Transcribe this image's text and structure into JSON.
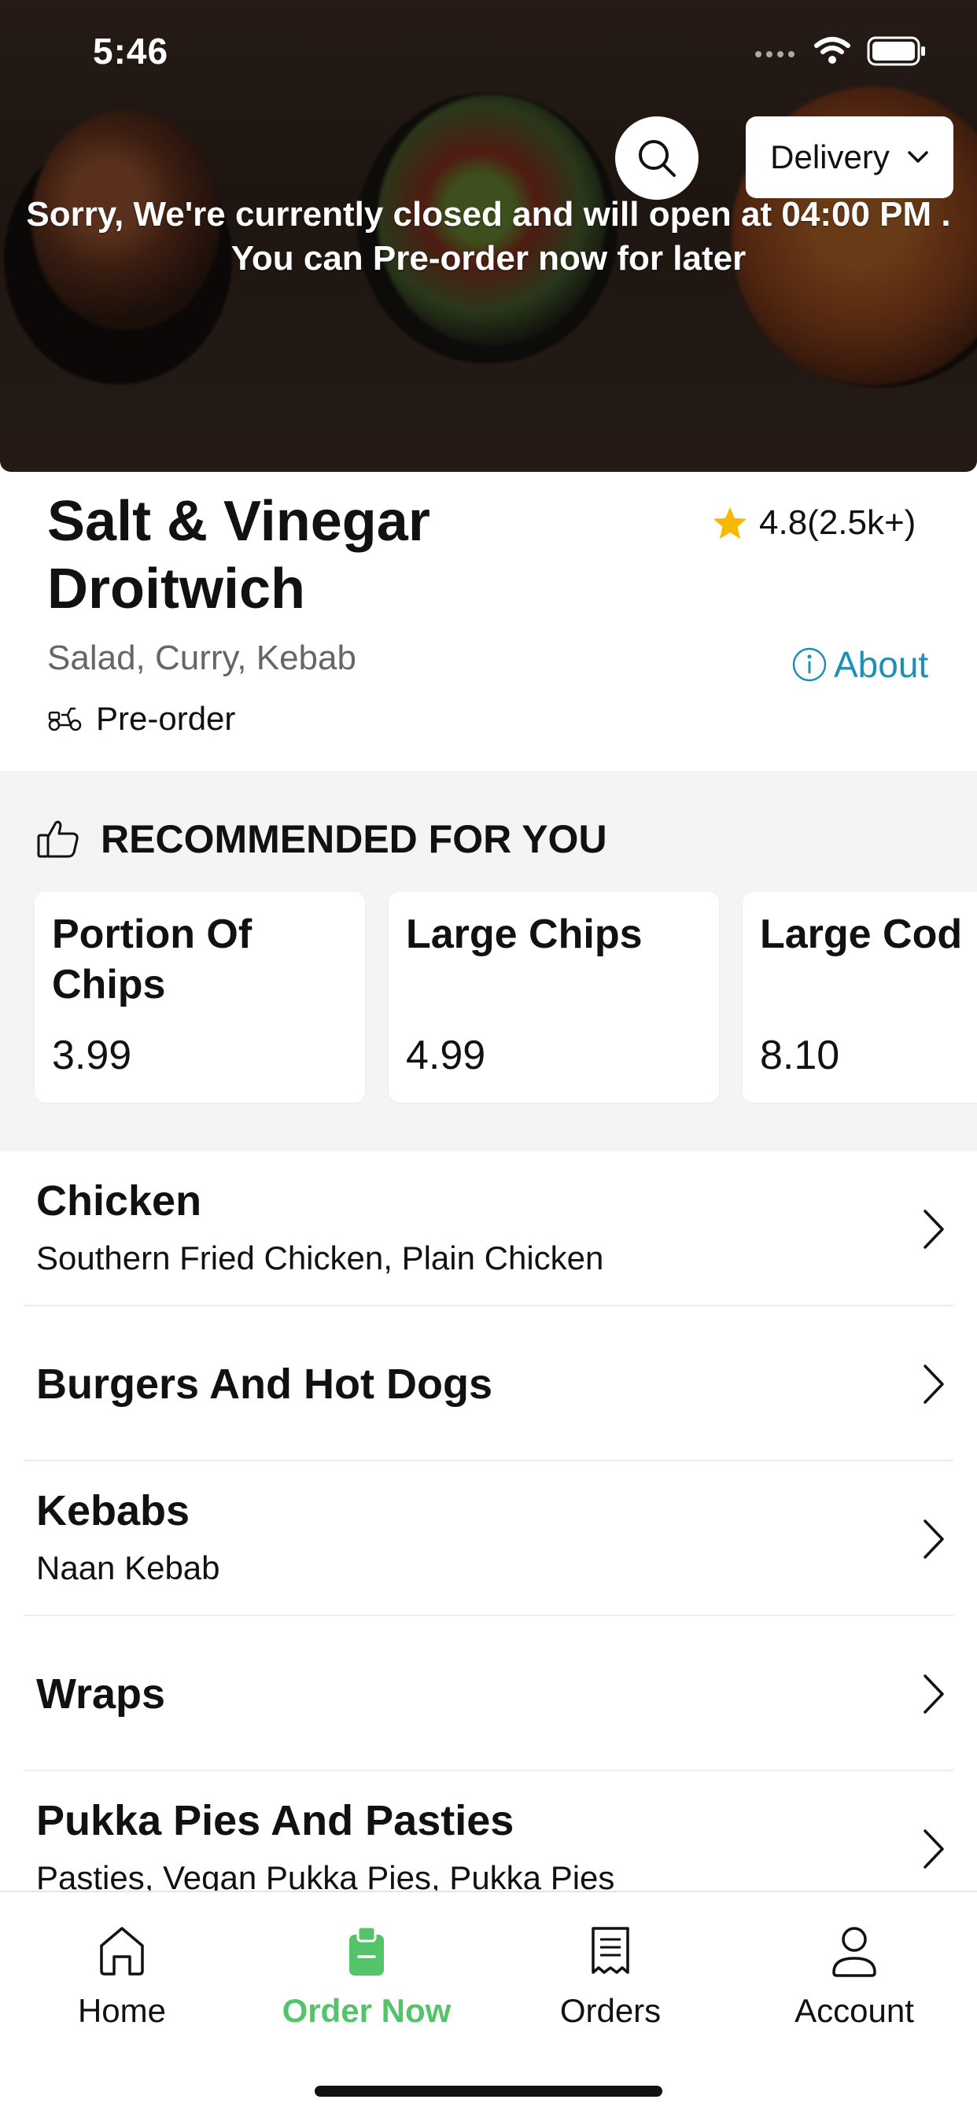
{
  "status_bar": {
    "time": "5:46"
  },
  "hero": {
    "delivery_label": "Delivery",
    "closed_line1": "Sorry, We're currently closed and will open at 04:00 PM .",
    "closed_line2": "You can Pre-order now for later"
  },
  "restaurant": {
    "name": "Salt & Vinegar Droitwich",
    "rating": "4.8(2.5k+)",
    "cuisines": "Salad, Curry, Kebab",
    "about_label": "About",
    "order_mode": "Pre-order"
  },
  "recommended": {
    "title": "RECOMMENDED FOR YOU",
    "items": [
      {
        "name": "Portion Of Chips",
        "price": "3.99"
      },
      {
        "name": "Large Chips",
        "price": "4.99"
      },
      {
        "name": "Large Cod",
        "price": "8.10"
      }
    ]
  },
  "categories": [
    {
      "title": "Chicken",
      "subtitle": "Southern Fried Chicken, Plain Chicken"
    },
    {
      "title": "Burgers And Hot Dogs",
      "subtitle": ""
    },
    {
      "title": "Kebabs",
      "subtitle": "Naan Kebab"
    },
    {
      "title": "Wraps",
      "subtitle": ""
    },
    {
      "title": "Pukka Pies And Pasties",
      "subtitle": "Pasties, Vegan Pukka Pies, Pukka Pies"
    }
  ],
  "bottom_nav": {
    "items": [
      {
        "label": "Home",
        "icon": "home-icon"
      },
      {
        "label": "Order Now",
        "icon": "order-bag-icon",
        "active": true
      },
      {
        "label": "Orders",
        "icon": "receipt-icon"
      },
      {
        "label": "Account",
        "icon": "account-icon"
      }
    ]
  },
  "colors": {
    "accent_green": "#55c36a",
    "link_blue": "#1f8fb8",
    "star_gold": "#f6b800"
  }
}
